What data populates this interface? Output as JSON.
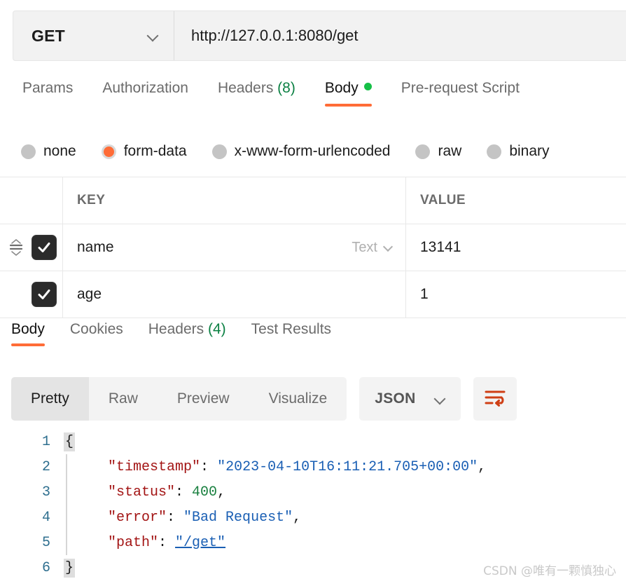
{
  "request_bar": {
    "method": "GET",
    "method_dropdown_icon": "chevron-down-icon",
    "url": "http://127.0.0.1:8080/get"
  },
  "request_tabs": [
    {
      "label": "Params",
      "active": false
    },
    {
      "label": "Authorization",
      "active": false
    },
    {
      "label": "Headers",
      "count": "(8)",
      "active": false
    },
    {
      "label": "Body",
      "active": true,
      "dot": true
    },
    {
      "label": "Pre-request Script",
      "active": false
    }
  ],
  "body_types": [
    {
      "label": "none",
      "selected": false
    },
    {
      "label": "form-data",
      "selected": true
    },
    {
      "label": "x-www-form-urlencoded",
      "selected": false
    },
    {
      "label": "raw",
      "selected": false
    },
    {
      "label": "binary",
      "selected": false
    }
  ],
  "kv_table": {
    "columns": {
      "key": "KEY",
      "value": "VALUE"
    },
    "rows": [
      {
        "checked": true,
        "key": "name",
        "type": "Text",
        "value": "13141",
        "has_drag_handle": true
      },
      {
        "checked": true,
        "key": "age",
        "type": "",
        "value": "1",
        "has_drag_handle": false
      }
    ]
  },
  "response_tabs": [
    {
      "label": "Body",
      "active": true
    },
    {
      "label": "Cookies",
      "active": false
    },
    {
      "label": "Headers",
      "count": "(4)",
      "active": false
    },
    {
      "label": "Test Results",
      "active": false
    }
  ],
  "view_toolbar": {
    "segments": [
      {
        "label": "Pretty",
        "active": true
      },
      {
        "label": "Raw",
        "active": false
      },
      {
        "label": "Preview",
        "active": false
      },
      {
        "label": "Visualize",
        "active": false
      }
    ],
    "format": "JSON",
    "format_dropdown_icon": "chevron-down-icon",
    "wrap_icon": "word-wrap-icon"
  },
  "json_body": {
    "line_numbers": [
      "1",
      "2",
      "3",
      "4",
      "5",
      "6"
    ],
    "open_brace": "{",
    "close_brace": "}",
    "entries": [
      {
        "key": "\"timestamp\"",
        "sep": ": ",
        "value": "\"2023-04-10T16:11:21.705+00:00\"",
        "kind": "string",
        "comma": ","
      },
      {
        "key": "\"status\"",
        "sep": ": ",
        "value": "400",
        "kind": "number",
        "comma": ","
      },
      {
        "key": "\"error\"",
        "sep": ": ",
        "value": "\"Bad Request\"",
        "kind": "string",
        "comma": ","
      },
      {
        "key": "\"path\"",
        "sep": ": ",
        "value": "\"/get\"",
        "kind": "link",
        "comma": ""
      }
    ],
    "indent": "    "
  },
  "watermark": "CSDN @唯有一颗慎独心",
  "colors": {
    "accent": "#ff6c37",
    "green": "#16c047",
    "count_green": "#0b8043",
    "json_key": "#a31515",
    "json_string": "#1a5fb4",
    "json_number": "#1a8040",
    "line_number": "#2f6f8f"
  }
}
